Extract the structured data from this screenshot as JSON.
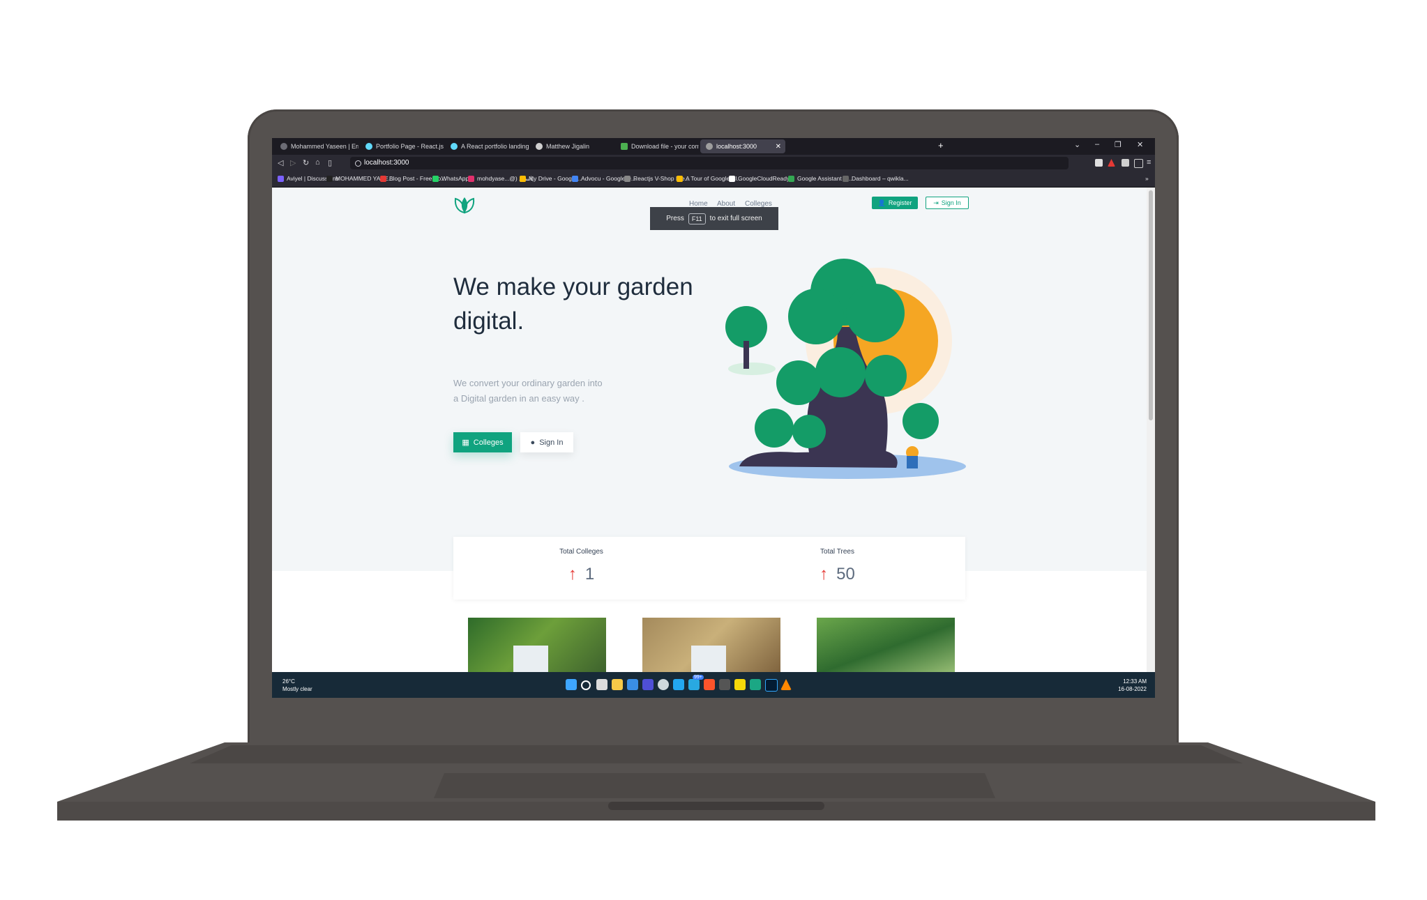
{
  "browser": {
    "tabs": [
      {
        "label": "Mohammed Yaseen | Ernakulam, India"
      },
      {
        "label": "Portfolio Page - React.js Examples"
      },
      {
        "label": "A React portfolio landing page using"
      },
      {
        "label": "Matthew Jigalin"
      },
      {
        "label": "Download file - your conversion was"
      },
      {
        "label": "localhost:3000"
      }
    ],
    "url": "localhost:3000",
    "bookmarks": [
      {
        "label": "Aviyel | Discussions",
        "color": "#7b61ff"
      },
      {
        "label": "MOHAMMED YASE...",
        "color": "#222222"
      },
      {
        "label": "Blog Post - Free Bo...",
        "color": "#e53935"
      },
      {
        "label": "WhatsApp",
        "color": "#25d366"
      },
      {
        "label": "mohdyase...@) ياسين",
        "color": "#e1306c"
      },
      {
        "label": "My Drive - Google...",
        "color": "#fbbc04"
      },
      {
        "label": "Advocu - Google D...",
        "color": "#4285f4"
      },
      {
        "label": "Reactjs V-Shop Fre...",
        "color": "#888888"
      },
      {
        "label": "A Tour of Google Cl...",
        "color": "#fbbc04"
      },
      {
        "label": "GoogleCloudReady...",
        "color": "#ffffff"
      },
      {
        "label": "Google Assistant B...",
        "color": "#34a853"
      },
      {
        "label": "Dashboard – qwikla...",
        "color": "#666666"
      }
    ]
  },
  "site": {
    "nav": {
      "home": "Home",
      "about": "About",
      "colleges": "Colleges"
    },
    "register_label": "Register",
    "signin_top_label": "Sign In",
    "toast": {
      "press": "Press",
      "key": "F11",
      "suffix": "to exit full screen"
    },
    "hero": {
      "title": "We make your garden digital.",
      "subtitle_line1": "We convert your ordinary garden into",
      "subtitle_line2": "a Digital garden in an easy way .",
      "colleges_button": "Colleges",
      "signin_button": "Sign In"
    },
    "stats": [
      {
        "label": "Total Colleges",
        "value": "1"
      },
      {
        "label": "Total Trees",
        "value": "50"
      }
    ],
    "accent_color": "#10a37f"
  },
  "taskbar": {
    "weather_temp": "26°C",
    "weather_desc": "Mostly clear",
    "time": "12:33 AM",
    "date": "16-08-2022",
    "badge": "99+"
  }
}
